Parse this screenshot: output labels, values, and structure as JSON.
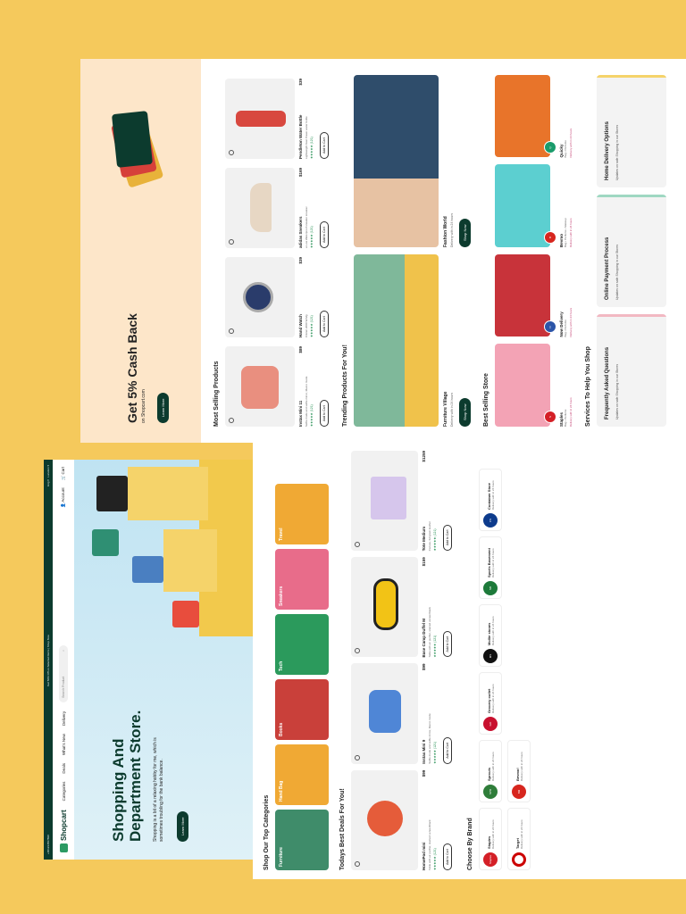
{
  "topbar": {
    "phone": "+001234567890",
    "promo": "Get 50% Off on Selected Items",
    "promo_link": "Shop Now",
    "lang": "Eng",
    "location": "Location"
  },
  "nav": {
    "brand": "Shopcart",
    "links": [
      "Categories",
      "Deals",
      "What's New",
      "Delivery"
    ],
    "search_placeholder": "Search Product",
    "account": "Account",
    "cart": "Cart"
  },
  "hero": {
    "title": "Shopping And Department Store.",
    "desc": "Shopping is a bit of a relaxing hobby for me, which is sometimes troubling for the bank balance.",
    "cta": "Learn More"
  },
  "categories": {
    "title": "Shop Our Top Categories",
    "items": [
      "Furniture",
      "Hand Bag",
      "Books",
      "Tech",
      "Sneakers",
      "Travel"
    ]
  },
  "deals": {
    "title": "Todays Best Deals For You!",
    "products": [
      {
        "name": "HomePod mini",
        "price": "$99",
        "desc": "Table with air purifier, stained veneer/black",
        "rating": "★★★★★ (121)",
        "add": "Add to Cart"
      },
      {
        "name": "Instax Mini 9",
        "price": "$99",
        "desc": "Selfie mode and selfie mirror, Macro mode",
        "rating": "★★★★★ (121)",
        "add": "Add to Cart"
      },
      {
        "name": "Base Camp Duffel M",
        "price": "$159",
        "desc": "Table with air purifier, stained veneer/black",
        "rating": "★★★★★ (121)",
        "add": "Add to Cart"
      },
      {
        "name": "Tote Medium",
        "price": "$1259",
        "desc": "Canvas, full grain leather",
        "rating": "★★★★★ (121)",
        "add": "Add to Cart"
      }
    ]
  },
  "brands": {
    "title": "Choose By Brand",
    "items": [
      {
        "name": "Staples",
        "sub": "Delivery with in 24 hours"
      },
      {
        "name": "Sprouts",
        "sub": "Delivery with in 24 hours"
      },
      {
        "name": "Grocery outlet",
        "sub": "Delivery with in 24 hours"
      },
      {
        "name": "Mollie stones",
        "sub": "Delivery with in 24 hours"
      },
      {
        "name": "Sports Basement",
        "sub": "Delivery with in 24 hours"
      },
      {
        "name": "Container Store",
        "sub": "Delivery with in 24 hours"
      },
      {
        "name": "Target",
        "sub": "Delivery with in 24 hours"
      },
      {
        "name": "Bevmo!",
        "sub": "Delivery with in 24 hours"
      }
    ]
  },
  "cashback": {
    "title": "Get 5% Cash Back",
    "sub": "on Shopcart.com",
    "cta": "Learn More"
  },
  "most_selling": {
    "title": "Most Selling Products",
    "products": [
      {
        "name": "Instax Mini 11",
        "price": "$89",
        "desc": "Selfie mode and selfie mirror, Macro mode",
        "rating": "★★★★★ (121)",
        "add": "Add to Cart"
      },
      {
        "name": "Hand Watch",
        "price": "$39",
        "desc": "Citizen 2000 W-Mg",
        "rating": "★★★★★ (121)",
        "add": "Add to Cart"
      },
      {
        "name": "adidas Sneakers",
        "price": "$169",
        "desc": "a Low Waterproof sneaker sneaker",
        "rating": "★★★★★ (121)",
        "add": "Add to Cart"
      },
      {
        "name": "Pendleton Water Bottle",
        "price": "$39",
        "desc": "Lightweight Kast Power water bottle",
        "rating": "★★★★★ (121)",
        "add": "Add to Cart"
      }
    ]
  },
  "trending": {
    "title": "Trending Products For You!",
    "items": [
      {
        "name": "Furniture Village",
        "sub": "Delivery with in 24 hours",
        "cta": "Shop Now"
      },
      {
        "name": "Fashion World",
        "sub": "Delivery with in 24 hours",
        "cta": "Shop Now"
      }
    ]
  },
  "best_store": {
    "title": "Best Selling Store",
    "items": [
      {
        "name": "Staples",
        "sub": "Bag • Perfume",
        "delivery": "Delivery with in 24 hours"
      },
      {
        "name": "Now Delivery",
        "sub": "Bag • Perfume",
        "delivery": "Delivery with in 24 hours"
      },
      {
        "name": "Bevmo",
        "sub": "Bag • Perfume • Makeup",
        "delivery": "Delivery with in 24 hours"
      },
      {
        "name": "Quicky",
        "sub": "Bag • Perfume",
        "delivery": "Delivery with in 24 hours"
      }
    ]
  },
  "services": {
    "title": "Services To Help You Shop",
    "items": [
      {
        "title": "Frequently Asked Questions",
        "sub": "Updates on safe Shopping in our Stores"
      },
      {
        "title": "Online Payment Process",
        "sub": "Updates on safe Shopping in our Stores"
      },
      {
        "title": "Home Delivery Options",
        "sub": "Updates on safe Shopping in our Stores"
      }
    ]
  }
}
